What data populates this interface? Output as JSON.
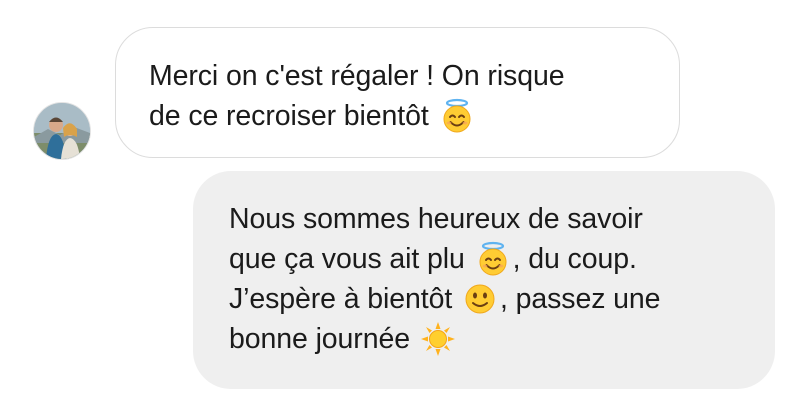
{
  "conversation": {
    "incoming": {
      "avatar_icon": "user-avatar-photo",
      "lines": [
        {
          "text": "Merci on c'est régaler ! On risque"
        },
        {
          "text": "de ce recroiser bientôt",
          "emoji_after": "smiling-face-with-halo-icon"
        }
      ]
    },
    "outgoing": {
      "lines": [
        {
          "text": "Nous sommes heureux de savoir"
        },
        {
          "text_before": "que ça vous ait plu",
          "emoji": "smiling-face-with-halo-icon",
          "text_after": ", du coup."
        },
        {
          "text_before": "J’espère à bientôt",
          "emoji": "slightly-smiling-face-icon",
          "text_after": ", passez une"
        },
        {
          "text": "bonne journée",
          "emoji_after": "sun-icon"
        }
      ]
    }
  },
  "colors": {
    "incoming_bubble_bg": "#ffffff",
    "incoming_bubble_border": "#dcdcdc",
    "outgoing_bubble_bg": "#efefef",
    "text": "#1b1b1b"
  }
}
